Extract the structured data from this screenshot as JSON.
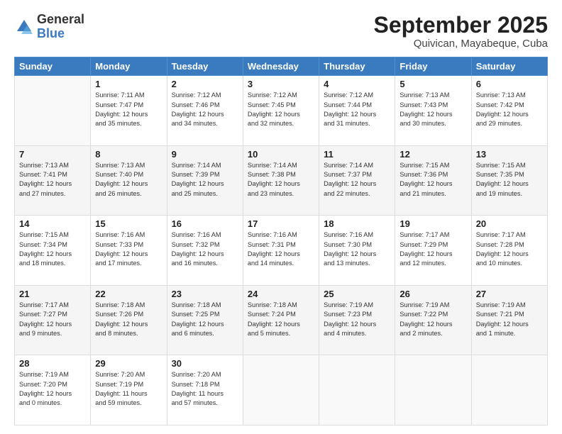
{
  "logo": {
    "general": "General",
    "blue": "Blue"
  },
  "header": {
    "month": "September 2025",
    "location": "Quivican, Mayabeque, Cuba"
  },
  "weekdays": [
    "Sunday",
    "Monday",
    "Tuesday",
    "Wednesday",
    "Thursday",
    "Friday",
    "Saturday"
  ],
  "weeks": [
    [
      {
        "day": "",
        "info": ""
      },
      {
        "day": "1",
        "info": "Sunrise: 7:11 AM\nSunset: 7:47 PM\nDaylight: 12 hours\nand 35 minutes."
      },
      {
        "day": "2",
        "info": "Sunrise: 7:12 AM\nSunset: 7:46 PM\nDaylight: 12 hours\nand 34 minutes."
      },
      {
        "day": "3",
        "info": "Sunrise: 7:12 AM\nSunset: 7:45 PM\nDaylight: 12 hours\nand 32 minutes."
      },
      {
        "day": "4",
        "info": "Sunrise: 7:12 AM\nSunset: 7:44 PM\nDaylight: 12 hours\nand 31 minutes."
      },
      {
        "day": "5",
        "info": "Sunrise: 7:13 AM\nSunset: 7:43 PM\nDaylight: 12 hours\nand 30 minutes."
      },
      {
        "day": "6",
        "info": "Sunrise: 7:13 AM\nSunset: 7:42 PM\nDaylight: 12 hours\nand 29 minutes."
      }
    ],
    [
      {
        "day": "7",
        "info": "Sunrise: 7:13 AM\nSunset: 7:41 PM\nDaylight: 12 hours\nand 27 minutes."
      },
      {
        "day": "8",
        "info": "Sunrise: 7:13 AM\nSunset: 7:40 PM\nDaylight: 12 hours\nand 26 minutes."
      },
      {
        "day": "9",
        "info": "Sunrise: 7:14 AM\nSunset: 7:39 PM\nDaylight: 12 hours\nand 25 minutes."
      },
      {
        "day": "10",
        "info": "Sunrise: 7:14 AM\nSunset: 7:38 PM\nDaylight: 12 hours\nand 23 minutes."
      },
      {
        "day": "11",
        "info": "Sunrise: 7:14 AM\nSunset: 7:37 PM\nDaylight: 12 hours\nand 22 minutes."
      },
      {
        "day": "12",
        "info": "Sunrise: 7:15 AM\nSunset: 7:36 PM\nDaylight: 12 hours\nand 21 minutes."
      },
      {
        "day": "13",
        "info": "Sunrise: 7:15 AM\nSunset: 7:35 PM\nDaylight: 12 hours\nand 19 minutes."
      }
    ],
    [
      {
        "day": "14",
        "info": "Sunrise: 7:15 AM\nSunset: 7:34 PM\nDaylight: 12 hours\nand 18 minutes."
      },
      {
        "day": "15",
        "info": "Sunrise: 7:16 AM\nSunset: 7:33 PM\nDaylight: 12 hours\nand 17 minutes."
      },
      {
        "day": "16",
        "info": "Sunrise: 7:16 AM\nSunset: 7:32 PM\nDaylight: 12 hours\nand 16 minutes."
      },
      {
        "day": "17",
        "info": "Sunrise: 7:16 AM\nSunset: 7:31 PM\nDaylight: 12 hours\nand 14 minutes."
      },
      {
        "day": "18",
        "info": "Sunrise: 7:16 AM\nSunset: 7:30 PM\nDaylight: 12 hours\nand 13 minutes."
      },
      {
        "day": "19",
        "info": "Sunrise: 7:17 AM\nSunset: 7:29 PM\nDaylight: 12 hours\nand 12 minutes."
      },
      {
        "day": "20",
        "info": "Sunrise: 7:17 AM\nSunset: 7:28 PM\nDaylight: 12 hours\nand 10 minutes."
      }
    ],
    [
      {
        "day": "21",
        "info": "Sunrise: 7:17 AM\nSunset: 7:27 PM\nDaylight: 12 hours\nand 9 minutes."
      },
      {
        "day": "22",
        "info": "Sunrise: 7:18 AM\nSunset: 7:26 PM\nDaylight: 12 hours\nand 8 minutes."
      },
      {
        "day": "23",
        "info": "Sunrise: 7:18 AM\nSunset: 7:25 PM\nDaylight: 12 hours\nand 6 minutes."
      },
      {
        "day": "24",
        "info": "Sunrise: 7:18 AM\nSunset: 7:24 PM\nDaylight: 12 hours\nand 5 minutes."
      },
      {
        "day": "25",
        "info": "Sunrise: 7:19 AM\nSunset: 7:23 PM\nDaylight: 12 hours\nand 4 minutes."
      },
      {
        "day": "26",
        "info": "Sunrise: 7:19 AM\nSunset: 7:22 PM\nDaylight: 12 hours\nand 2 minutes."
      },
      {
        "day": "27",
        "info": "Sunrise: 7:19 AM\nSunset: 7:21 PM\nDaylight: 12 hours\nand 1 minute."
      }
    ],
    [
      {
        "day": "28",
        "info": "Sunrise: 7:19 AM\nSunset: 7:20 PM\nDaylight: 12 hours\nand 0 minutes."
      },
      {
        "day": "29",
        "info": "Sunrise: 7:20 AM\nSunset: 7:19 PM\nDaylight: 11 hours\nand 59 minutes."
      },
      {
        "day": "30",
        "info": "Sunrise: 7:20 AM\nSunset: 7:18 PM\nDaylight: 11 hours\nand 57 minutes."
      },
      {
        "day": "",
        "info": ""
      },
      {
        "day": "",
        "info": ""
      },
      {
        "day": "",
        "info": ""
      },
      {
        "day": "",
        "info": ""
      }
    ]
  ]
}
